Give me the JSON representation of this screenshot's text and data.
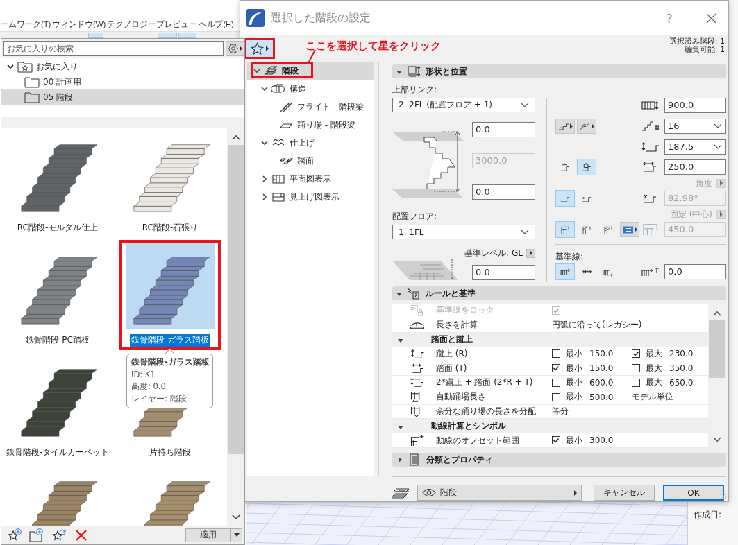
{
  "menu_bar": [
    {
      "label": "ームワーク(T)"
    },
    {
      "label": "ウィンドウ(W)"
    },
    {
      "label": "テクノロジープレビュー"
    },
    {
      "label": "ヘルプ(H)"
    }
  ],
  "favorites": {
    "search": {
      "placeholder": "お気に入りの検索"
    },
    "tree": [
      {
        "label": "お気に入り",
        "kind": "favorites",
        "expanded": true,
        "selected": false,
        "children": [
          {
            "label": "00 計画用",
            "kind": "folder",
            "selected": false
          },
          {
            "label": "05 階段",
            "kind": "folder",
            "selected": true
          }
        ]
      }
    ],
    "items": [
      {
        "label": "RC階段-モルタル仕上",
        "color": "#5f6467",
        "selected": false,
        "highlighted": false
      },
      {
        "label": "RC階段-石張り",
        "color": "#ebe8e1",
        "selected": false,
        "highlighted": false
      },
      {
        "label": "鉄骨階段-PC踏板",
        "color": "#7f8386",
        "selected": false,
        "highlighted": false
      },
      {
        "label": "鉄骨階段-ガラス踏板",
        "color": "#7587b4",
        "selected": true,
        "highlighted": true
      },
      {
        "label": "鉄骨階段-タイルカーペット",
        "color": "#3c4337",
        "selected": false,
        "highlighted": false
      },
      {
        "label": "片持ち階段",
        "color": "#a38f70",
        "selected": false,
        "highlighted": false
      },
      {
        "color": "#9a8464",
        "selected": false,
        "highlighted": false
      },
      {
        "color": "#a48e6c",
        "selected": false,
        "highlighted": false
      }
    ],
    "tooltip": {
      "title": "鉄骨階段-ガラス踏板",
      "lines": [
        "ID: K1",
        "高度: 0.0",
        "レイヤー: 階段"
      ]
    },
    "apply_button": {
      "label": "適用"
    }
  },
  "dialog": {
    "title": "選択した階段の設定",
    "help_label": "?",
    "favorites_button": {
      "highlighted": true
    },
    "callout": "ここを選択して星をクリック",
    "selection_info": [
      "選択済み階段: 1",
      "編集可能: 1"
    ],
    "tree": [
      {
        "label": "階段",
        "kind": "stair",
        "expanded": true,
        "selected": true,
        "highlighted": true,
        "children": [
          {
            "label": "構造",
            "kind": "structure",
            "expanded": true,
            "selected": false,
            "highlighted": false,
            "children": [
              {
                "label": "フライト - 階段梁",
                "kind": "flight",
                "selected": false,
                "highlighted": false
              },
              {
                "label": "踊り場 - 階段梁",
                "kind": "landing",
                "selected": false,
                "highlighted": false
              }
            ]
          },
          {
            "label": "仕上げ",
            "kind": "finish",
            "expanded": true,
            "selected": false,
            "highlighted": false,
            "children": [
              {
                "label": "踏面",
                "kind": "tread",
                "selected": false,
                "highlighted": false
              }
            ]
          },
          {
            "label": "平面図表示",
            "kind": "plan",
            "expanded": false,
            "selected": false,
            "highlighted": false
          },
          {
            "label": "見上げ図表示",
            "kind": "ceiling",
            "expanded": false,
            "selected": false,
            "highlighted": false
          }
        ]
      }
    ],
    "shape_section": {
      "title": "形状と位置",
      "expanded": true,
      "top_link": {
        "label": "上部リンク:",
        "value": "2. 2FL (配置フロア + 1)"
      },
      "top_offset": {
        "value": "0.0",
        "disabled": false
      },
      "stair_height": {
        "value": "3000.0",
        "disabled": true
      },
      "bottom_offset": {
        "value": "0.0",
        "disabled": false
      },
      "home_floor": {
        "label": "配置フロア:",
        "value": "1. 1FL"
      },
      "reference_level": {
        "label": "基準レベル: GL",
        "value": "0.0"
      },
      "width": {
        "value": "900.0"
      },
      "riser_count": {
        "value": "16"
      },
      "riser_height": {
        "value": "187.5"
      },
      "tread_depth": {
        "value": "250.0",
        "options": [
          {
            "selected": false
          },
          {
            "selected": true
          }
        ]
      },
      "angle": {
        "label": "角度",
        "disabled": true,
        "value": "82.98°",
        "options": [
          {
            "selected": true
          },
          {
            "selected": false
          }
        ]
      },
      "walking_line": {
        "label": "固定 (中心)",
        "disabled": true,
        "value": "450.0",
        "options": [
          {
            "selected": true
          },
          {
            "selected": false
          },
          {
            "selected": false
          }
        ]
      },
      "baseline": {
        "label": "基準線:",
        "value": "0.0",
        "options": [
          {
            "selected": true
          },
          {
            "selected": false
          },
          {
            "selected": false
          }
        ]
      }
    },
    "rules_section": {
      "title": "ルールと基準",
      "expanded": true,
      "rows": [
        {
          "kind": "check",
          "label": "基準線をロック",
          "disabled": true,
          "checked": true
        },
        {
          "kind": "value",
          "label": "長さを計算",
          "value": "円弧に沿って(レガシー)",
          "disabled": false
        },
        {
          "kind": "group",
          "label": "踏面と蹴上",
          "expanded": true
        },
        {
          "kind": "range",
          "label": "蹴上 (R)",
          "disabled": false,
          "min": {
            "label": "最小",
            "checked": false,
            "value": "150.0"
          },
          "max": {
            "label": "最大",
            "checked": true,
            "value": "230.0"
          }
        },
        {
          "kind": "range",
          "label": "踏面 (T)",
          "disabled": false,
          "min": {
            "label": "最小",
            "checked": true,
            "value": "150.0"
          },
          "max": {
            "label": "最大",
            "checked": false,
            "value": "350.0"
          }
        },
        {
          "kind": "range",
          "label": "2*蹴上 + 踏面 (2*R + T)",
          "disabled": false,
          "min": {
            "label": "最小",
            "checked": false,
            "value": "600.0"
          },
          "max": {
            "label": "最大",
            "checked": false,
            "value": "650.0"
          }
        },
        {
          "kind": "range",
          "label": "自動踊場長さ",
          "disabled": false,
          "min": {
            "label": "最小",
            "checked": false,
            "value": "500.0"
          },
          "note": "モデル単位"
        },
        {
          "kind": "value",
          "label": "余分な踊り場の長さを分配",
          "value": "等分",
          "disabled": false
        },
        {
          "kind": "group",
          "label": "動線計算とシンボル",
          "expanded": true
        },
        {
          "kind": "range",
          "label": "動線のオフセット範囲",
          "disabled": false,
          "min": {
            "label": "最小",
            "checked": true,
            "value": "300.0"
          }
        }
      ]
    },
    "classification_section": {
      "title": "分類とプロパティ",
      "expanded": false
    },
    "layer": {
      "value": "階段"
    },
    "buttons": [
      {
        "label": "キャンセル",
        "default": false
      },
      {
        "label": "OK",
        "default": true
      }
    ]
  },
  "info_panel": {
    "label": "作成日:"
  }
}
